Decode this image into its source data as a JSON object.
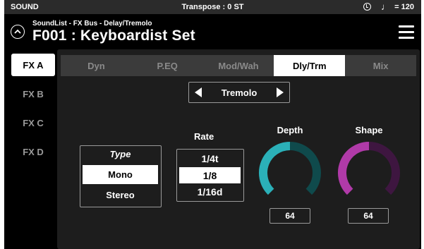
{
  "status": {
    "mode": "SOUND",
    "transpose": "Transpose : 0 ST",
    "tempo_icon": "metronome-clock-icon",
    "tempo_note": "♩",
    "tempo": "= 120"
  },
  "header": {
    "subtitle": "SoundList - FX Bus - Delay/Tremolo",
    "title": "F001 : Keyboardist Set",
    "up_icon": "chevron-up-icon",
    "menu_icon": "hamburger-menu-icon"
  },
  "fx_tabs": [
    {
      "label": "FX A",
      "active": true
    },
    {
      "label": "FX B",
      "active": false
    },
    {
      "label": "FX C",
      "active": false
    },
    {
      "label": "FX D",
      "active": false
    }
  ],
  "top_tabs": [
    {
      "label": "Dyn",
      "active": false
    },
    {
      "label": "P.EQ",
      "active": false
    },
    {
      "label": "Mod/Wah",
      "active": false
    },
    {
      "label": "Dly/Trm",
      "active": true
    },
    {
      "label": "Mix",
      "active": false
    }
  ],
  "effect_selector": {
    "value": "Tremolo",
    "prev_icon": "triangle-left-icon",
    "next_icon": "triangle-right-icon"
  },
  "type": {
    "label": "Type",
    "options": [
      "Mono",
      "Stereo"
    ],
    "selected": "Mono"
  },
  "rate": {
    "label": "Rate",
    "options": [
      "1/4t",
      "1/8",
      "1/16d"
    ],
    "selected": "1/8"
  },
  "depth": {
    "label": "Depth",
    "value": "64",
    "level": 0.5,
    "color_active": "#2bb0b8",
    "color_track": "#0f4a4c"
  },
  "shape": {
    "label": "Shape",
    "value": "64",
    "level": 0.5,
    "color_active": "#b03aa8",
    "color_track": "#3e1640"
  }
}
